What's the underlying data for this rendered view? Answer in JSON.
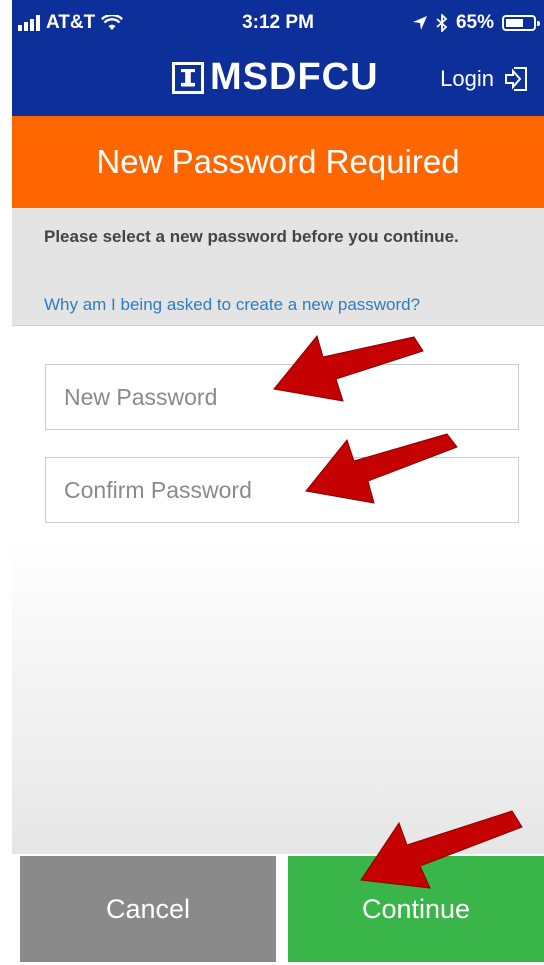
{
  "status_bar": {
    "carrier": "AT&T",
    "time": "3:12 PM",
    "battery": "65%",
    "battery_level": 0.65,
    "icons": [
      "signal-icon",
      "wifi-icon",
      "location-icon",
      "bluetooth-icon",
      "battery-icon"
    ]
  },
  "header": {
    "brand": "MSDFCU",
    "login_label": "Login",
    "colors": {
      "header_bg": "#0c2f9a"
    }
  },
  "page": {
    "title": "New Password Required",
    "title_bg": "#ff6600"
  },
  "info": {
    "message": "Please select a new password before you continue.",
    "why_link": "Why am I being asked to create a new password?"
  },
  "form": {
    "new_password": {
      "placeholder": "New Password",
      "value": ""
    },
    "confirm_password": {
      "placeholder": "Confirm Password",
      "value": ""
    }
  },
  "buttons": {
    "cancel": "Cancel",
    "continue": "Continue",
    "cancel_bg": "#8a8a8a",
    "continue_bg": "#3ab54a"
  },
  "annotations": {
    "arrow_color": "#c40000",
    "arrow_targets": [
      "new-password-field",
      "confirm-password-field",
      "continue-button"
    ]
  }
}
